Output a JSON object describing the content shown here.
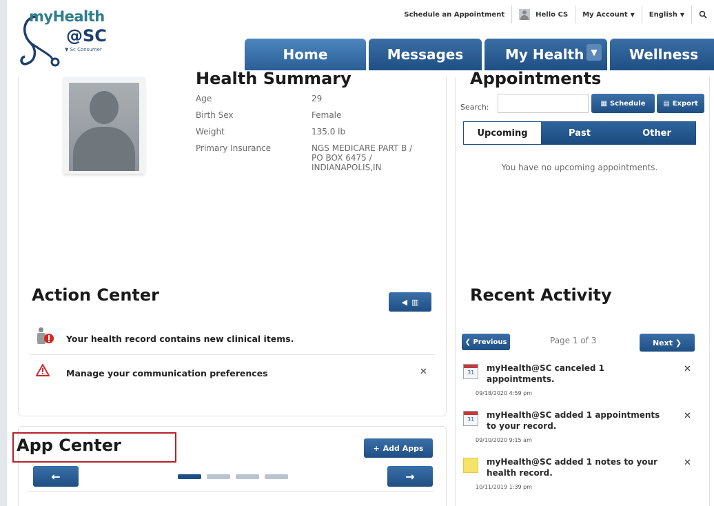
{
  "header": {
    "logo_main": "myHealth",
    "logo_sub": "@SC",
    "logo_tagline": "▼ Sc Consumer",
    "links": {
      "schedule": "Schedule an Appointment",
      "greeting": "Hello CS",
      "account": "My Account",
      "language": "English"
    },
    "tabs": {
      "home": "Home",
      "messages": "Messages",
      "myhealth": "My Health",
      "wellness": "Wellness"
    }
  },
  "health_summary": {
    "title": "Health Summary",
    "rows": [
      {
        "label": "Age",
        "value": "29"
      },
      {
        "label": "Birth Sex",
        "value": "Female"
      },
      {
        "label": "Weight",
        "value": "135.0 lb"
      },
      {
        "label": "Primary Insurance",
        "value_lines": [
          "NGS MEDICARE PART B /",
          "PO BOX 6475 /",
          "INDIANAPOLIS,IN"
        ]
      }
    ]
  },
  "action_center": {
    "title": "Action Center",
    "items": [
      "Your health record contains new clinical items.",
      "Manage your communication preferences"
    ]
  },
  "app_center": {
    "title": "App Center",
    "add_label": "Add Apps"
  },
  "appointments": {
    "title": "Appointments",
    "search_label": "Search:",
    "schedule_label": "Schedule",
    "export_label": "Export",
    "tabs": [
      "Upcoming",
      "Past",
      "Other"
    ],
    "empty_text": "You have no upcoming appointments."
  },
  "recent_activity": {
    "title": "Recent Activity",
    "prev_label": "Previous",
    "next_label": "Next",
    "pager": "Page 1 of 3",
    "items": [
      {
        "lines": [
          "myHealth@SC canceled 1",
          "appointments."
        ],
        "date": "09/18/2020 4:59 pm",
        "icon": "calendar-icon"
      },
      {
        "lines": [
          "myHealth@SC added 1 appointments",
          "to your record."
        ],
        "date": "09/10/2020 9:15 am",
        "icon": "calendar-icon"
      },
      {
        "lines": [
          "myHealth@SC added 1 notes to your",
          "health record."
        ],
        "date": "10/11/2019 1:39 pm",
        "icon": "note-icon"
      }
    ]
  },
  "colors": {
    "nav_blue": "#1e4f85",
    "highlight_red": "#b62025",
    "warning_red": "#cc2a2a"
  }
}
